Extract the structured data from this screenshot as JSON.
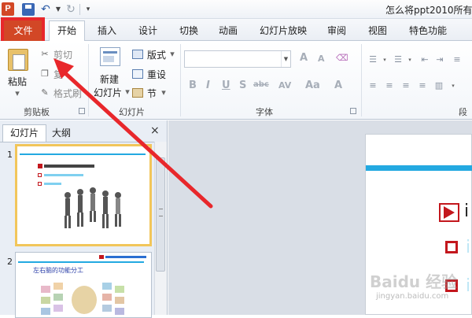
{
  "window": {
    "app_icon": "P",
    "title": "怎么将ppt2010所有"
  },
  "quick_access": {
    "save_icon": "save-icon",
    "undo_icon": "undo-icon",
    "redo_icon": "redo-icon",
    "customize_icon": "customize-qat-icon"
  },
  "tabs": {
    "file": "文件",
    "home": "开始",
    "insert": "插入",
    "design": "设计",
    "transitions": "切换",
    "animations": "动画",
    "slideshow": "幻灯片放映",
    "review": "审阅",
    "view": "视图",
    "special": "特色功能"
  },
  "ribbon": {
    "clipboard": {
      "paste": "粘贴",
      "cut": "剪切",
      "copy": "复",
      "format_painter": "格式刷",
      "label": "剪贴板"
    },
    "slides": {
      "new_slide_line1": "新建",
      "new_slide_line2": "幻灯片",
      "layout": "版式",
      "reset": "重设",
      "section": "节",
      "label": "幻灯片"
    },
    "font": {
      "label": "字体",
      "grow": "A",
      "shrink": "A",
      "bold": "B",
      "italic": "I",
      "underline": "U",
      "strike": "S",
      "shadow": "abc",
      "spacing": "AV",
      "case": "Aa",
      "color": "A"
    },
    "paragraph": {
      "label": "段"
    }
  },
  "panel": {
    "tab_slides": "幻灯片",
    "tab_outline": "大纲",
    "close": "×",
    "slide1_number": "1",
    "slide2_number": "2",
    "slide2_title": "左右脑的功能分工"
  },
  "editor": {
    "line1_char": "i",
    "line2_char": "i",
    "line3_char": "i"
  },
  "watermark": {
    "text": "Baidu 经验",
    "url": "jingyan.baidu.com"
  },
  "colors": {
    "file_tab": "#d24726",
    "highlight": "#e8272b",
    "accent_blue": "#23a9e1",
    "bullet_red": "#c3171d"
  }
}
